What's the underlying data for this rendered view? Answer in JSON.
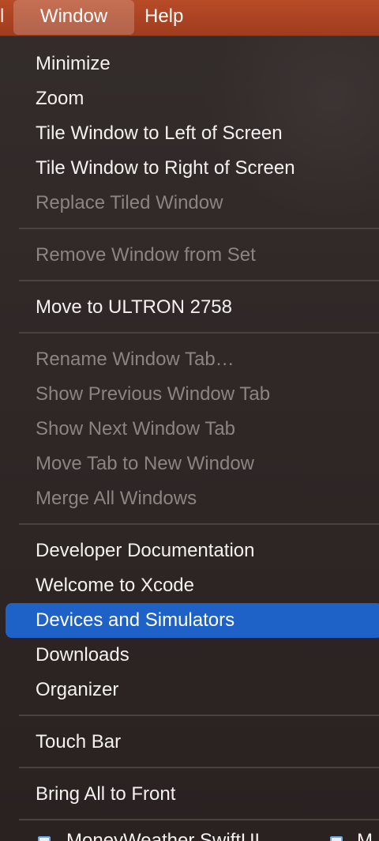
{
  "menubar": {
    "window": "Window",
    "help": "Help"
  },
  "menu": {
    "items": [
      {
        "label": "Minimize",
        "enabled": true
      },
      {
        "label": "Zoom",
        "enabled": true
      },
      {
        "label": "Tile Window to Left of Screen",
        "enabled": true
      },
      {
        "label": "Tile Window to Right of Screen",
        "enabled": true
      },
      {
        "label": "Replace Tiled Window",
        "enabled": false
      },
      {
        "label": "Remove Window from Set",
        "enabled": false
      },
      {
        "label": "Move to ULTRON 2758",
        "enabled": true
      },
      {
        "label": "Rename Window Tab…",
        "enabled": false
      },
      {
        "label": "Show Previous Window Tab",
        "enabled": false
      },
      {
        "label": "Show Next Window Tab",
        "enabled": false
      },
      {
        "label": "Move Tab to New Window",
        "enabled": false
      },
      {
        "label": "Merge All Windows",
        "enabled": false
      },
      {
        "label": "Developer Documentation",
        "enabled": true
      },
      {
        "label": "Welcome to Xcode",
        "enabled": true
      },
      {
        "label": "Devices and Simulators",
        "enabled": true,
        "selected": true
      },
      {
        "label": "Downloads",
        "enabled": true
      },
      {
        "label": "Organizer",
        "enabled": true
      },
      {
        "label": "Touch Bar",
        "enabled": true
      },
      {
        "label": "Bring All to Front",
        "enabled": true
      }
    ],
    "bottom_windows": [
      {
        "label": "MoneyWeather SwiftUI",
        "icon": "document-icon"
      },
      {
        "label": "M",
        "icon": "document-icon"
      }
    ]
  }
}
